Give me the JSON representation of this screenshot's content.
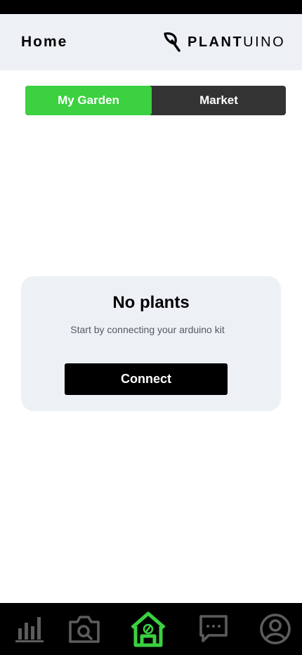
{
  "header": {
    "title": "Home",
    "logo": {
      "bold": "PLANT",
      "light": "UINO",
      "icon": "leaf-icon"
    }
  },
  "segmented": {
    "tabs": [
      {
        "label": "My Garden",
        "active": true
      },
      {
        "label": "Market",
        "active": false
      }
    ]
  },
  "empty_state": {
    "title": "No plants",
    "subtitle": "Start by connecting your arduino kit",
    "button": "Connect"
  },
  "bottom_nav": {
    "items": [
      {
        "icon": "bar-chart-icon",
        "active": false
      },
      {
        "icon": "camera-search-icon",
        "active": false
      },
      {
        "icon": "greenhouse-icon",
        "active": true
      },
      {
        "icon": "chat-icon",
        "active": false
      },
      {
        "icon": "profile-icon",
        "active": false
      }
    ]
  },
  "colors": {
    "accent": "#3bd140",
    "header_bg": "#edf1f6",
    "card_bg": "#edf1f6",
    "nav_bg": "#000000",
    "nav_icon": "#5c5c5c",
    "segment_bg": "#333333"
  }
}
